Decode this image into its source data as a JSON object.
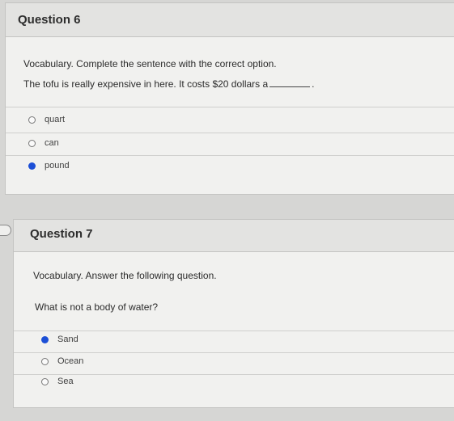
{
  "question6": {
    "title": "Question 6",
    "instruction": "Vocabulary. Complete the sentence with the correct option.",
    "sentence_before": "The tofu is really expensive in here. It costs $20 dollars a",
    "sentence_after": ".",
    "options": [
      {
        "label": "quart",
        "selected": false
      },
      {
        "label": "can",
        "selected": false
      },
      {
        "label": "pound",
        "selected": true
      }
    ]
  },
  "question7": {
    "title": "Question 7",
    "instruction": "Vocabulary. Answer the following question.",
    "question": "What is not a body of water?",
    "options": [
      {
        "label": "Sand",
        "selected": true
      },
      {
        "label": "Ocean",
        "selected": false
      },
      {
        "label": "Sea",
        "selected": false
      }
    ]
  },
  "colors": {
    "selected_radio": "#1c4fd6",
    "card_bg": "#f1f1ef",
    "header_bg": "#e3e3e1"
  },
  "icons": {
    "nav": "nav-arrow-icon"
  }
}
